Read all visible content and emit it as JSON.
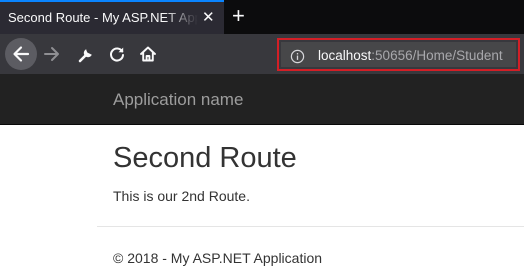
{
  "browser": {
    "tab_title": "Second Route - My ASP.NET Application",
    "tab_close": "✕",
    "new_tab": "+",
    "url_host": "localhost",
    "url_path": ":50656/Home/Student",
    "icons": [
      "back-arrow-icon",
      "forward-arrow-icon",
      "wrench-icon",
      "reload-icon",
      "home-icon",
      "info-icon"
    ],
    "colors": {
      "highlight": "#d31f26",
      "tab_accent": "#0a84ff",
      "toolbar": "#38383d"
    }
  },
  "site": {
    "app_name": "Application name",
    "heading": "Second Route",
    "body": "This is our 2nd Route.",
    "footer": "© 2018 - My ASP.NET Application"
  }
}
